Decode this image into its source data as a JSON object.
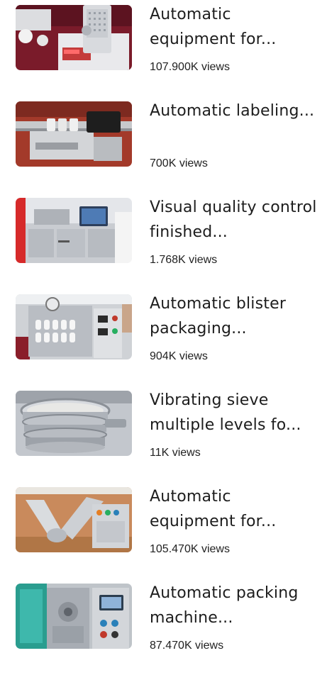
{
  "videos": [
    {
      "title": "Automatic equipment for...",
      "views": "107.900K views",
      "thumbnail_icon": "pharma-tester-icon"
    },
    {
      "title": "Automatic labeling...",
      "views": "700K views",
      "thumbnail_icon": "labeling-machine-icon"
    },
    {
      "title": "Visual quality control finished...",
      "views": "1.768K views",
      "thumbnail_icon": "inspection-machine-icon"
    },
    {
      "title": "Automatic blister packaging...",
      "views": "904K views",
      "thumbnail_icon": "blister-machine-icon"
    },
    {
      "title": "Vibrating sieve multiple levels fo...",
      "views": "11K views",
      "thumbnail_icon": "vibrating-sieve-icon"
    },
    {
      "title": "Automatic equipment for...",
      "views": "105.470K views",
      "thumbnail_icon": "v-mixer-icon"
    },
    {
      "title": "Automatic packing machine...",
      "views": "87.470K views",
      "thumbnail_icon": "packing-machine-icon"
    }
  ]
}
